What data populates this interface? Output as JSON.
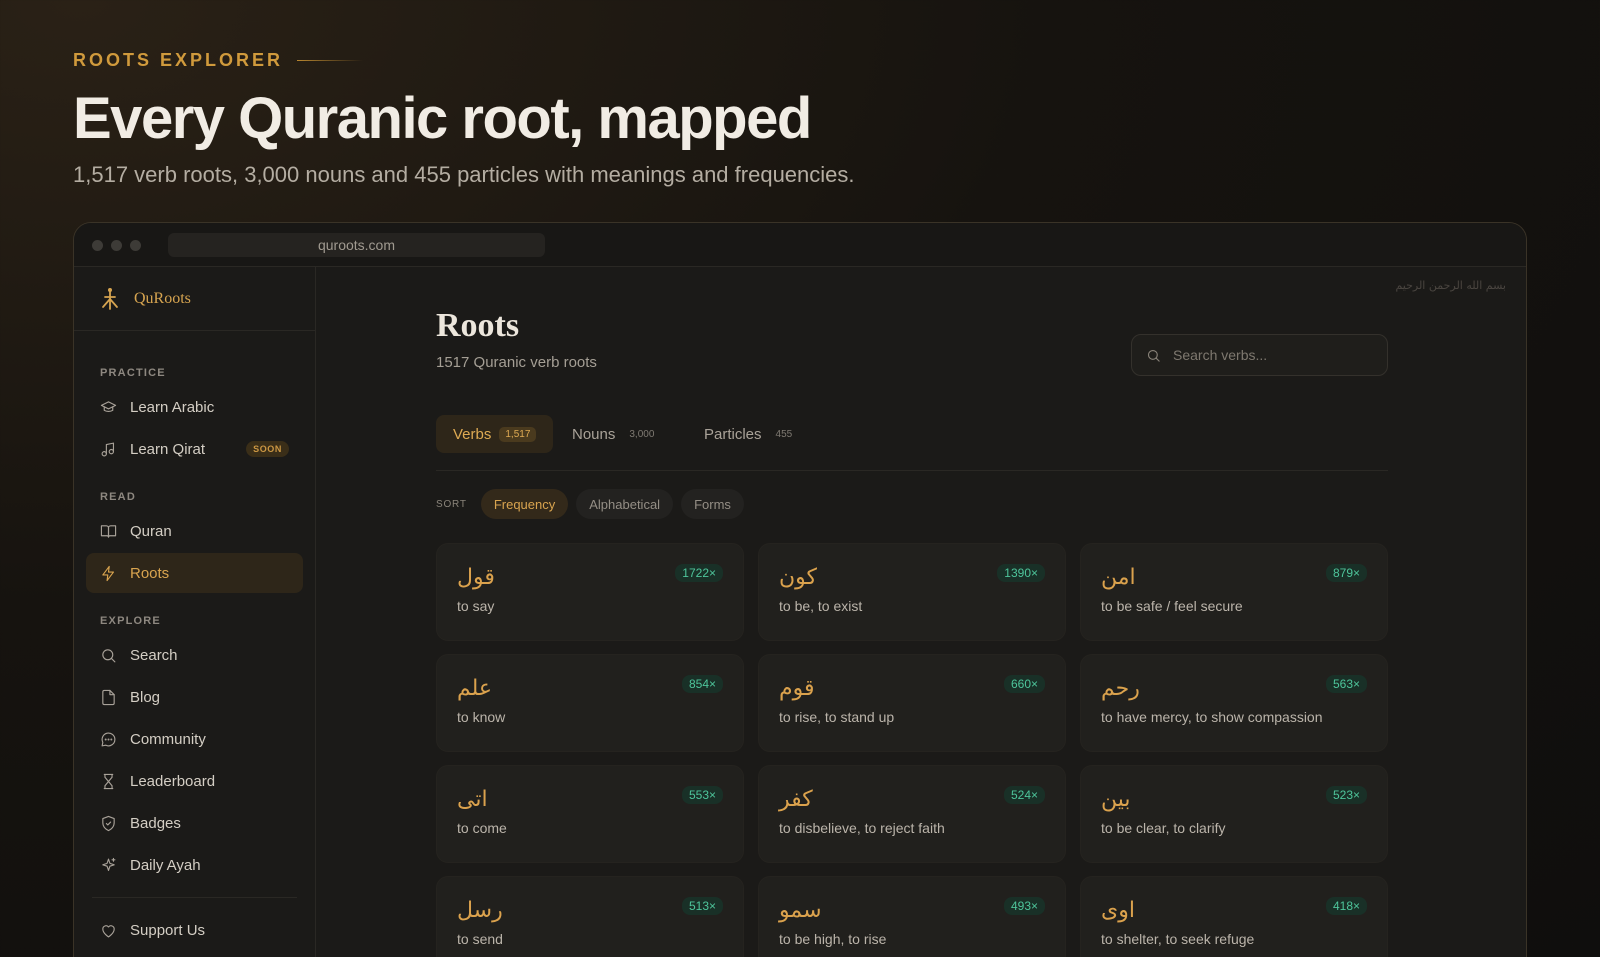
{
  "hero": {
    "eyebrow": "ROOTS EXPLORER",
    "title": "Every Quranic root, mapped",
    "subtitle": "1,517 verb roots, 3,000 nouns and 455 particles with meanings and frequencies."
  },
  "browser": {
    "url": "quroots.com"
  },
  "sidebar": {
    "logo": "QuRoots",
    "practice_label": "PRACTICE",
    "practice": [
      {
        "label": "Learn Arabic",
        "icon": "graduation-cap-icon"
      },
      {
        "label": "Learn Qirat",
        "icon": "music-note-icon",
        "badge": "SOON"
      }
    ],
    "read_label": "READ",
    "read": [
      {
        "label": "Quran",
        "icon": "book-open-icon"
      },
      {
        "label": "Roots",
        "icon": "lightning-icon",
        "active": true
      }
    ],
    "explore_label": "EXPLORE",
    "explore": [
      {
        "label": "Search",
        "icon": "search-icon"
      },
      {
        "label": "Blog",
        "icon": "document-icon"
      },
      {
        "label": "Community",
        "icon": "chat-bubble-icon"
      },
      {
        "label": "Leaderboard",
        "icon": "hourglass-icon"
      },
      {
        "label": "Badges",
        "icon": "shield-check-icon"
      },
      {
        "label": "Daily Ayah",
        "icon": "sparkle-icon"
      }
    ],
    "support": {
      "label": "Support Us",
      "icon": "heart-icon"
    }
  },
  "main": {
    "bismillah": "بسم الله الرحمن الرحيم",
    "title": "Roots",
    "subtitle": "1517 Quranic verb roots",
    "search_placeholder": "Search verbs...",
    "tabs": [
      {
        "label": "Verbs",
        "count": "1,517",
        "active": true
      },
      {
        "label": "Nouns",
        "count": "3,000"
      },
      {
        "label": "Particles",
        "count": "455"
      }
    ],
    "sort_label": "SORT",
    "sort_options": [
      "Frequency",
      "Alphabetical",
      "Forms"
    ],
    "sort_active": "Frequency",
    "roots": [
      {
        "arabic": "قول",
        "meaning": "to say",
        "freq": "1722×"
      },
      {
        "arabic": "كون",
        "meaning": "to be, to exist",
        "freq": "1390×"
      },
      {
        "arabic": "امن",
        "meaning": "to be safe / feel secure",
        "freq": "879×"
      },
      {
        "arabic": "علم",
        "meaning": "to know",
        "freq": "854×"
      },
      {
        "arabic": "قوم",
        "meaning": "to rise, to stand up",
        "freq": "660×"
      },
      {
        "arabic": "رحم",
        "meaning": "to have mercy, to show compassion",
        "freq": "563×"
      },
      {
        "arabic": "اتى",
        "meaning": "to come",
        "freq": "553×"
      },
      {
        "arabic": "كفر",
        "meaning": "to disbelieve, to reject faith",
        "freq": "524×"
      },
      {
        "arabic": "بين",
        "meaning": "to be clear, to clarify",
        "freq": "523×"
      },
      {
        "arabic": "رسل",
        "meaning": "to send",
        "freq": "513×"
      },
      {
        "arabic": "سمو",
        "meaning": "to be high, to rise",
        "freq": "493×"
      },
      {
        "arabic": "اوى",
        "meaning": "to shelter, to seek refuge",
        "freq": "418×"
      }
    ]
  },
  "colors": {
    "accent": "#d9a44f",
    "freq_badge": "#4ec59b",
    "background": "#1b1a18"
  }
}
